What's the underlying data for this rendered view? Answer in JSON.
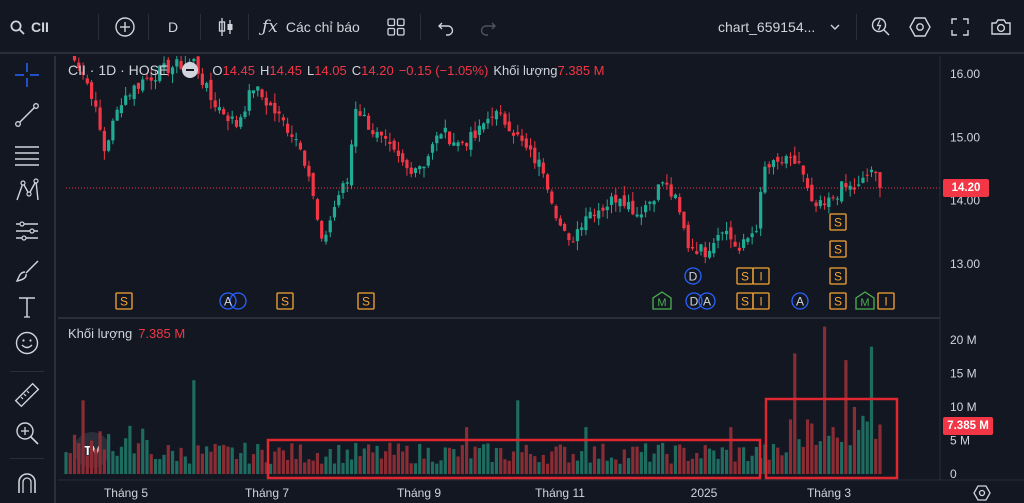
{
  "toolbar": {
    "symbol": "CII",
    "interval": "D",
    "indicators_label": "Các chỉ báo",
    "layout_name": "chart_659154...",
    "colors": {
      "bg": "#131722",
      "text": "#d1d4dc"
    }
  },
  "left_tools": [
    "crosshair-icon",
    "trendline-icon",
    "fib-icon",
    "pattern-icon",
    "projection-icon",
    "brush-icon",
    "text-icon",
    "emoji-icon",
    "ruler-icon",
    "zoom-icon",
    "magnet-icon"
  ],
  "legend": {
    "title": "CII · 1D · HOSE",
    "o_label": "O",
    "o_value": "14.45",
    "h_label": "H",
    "h_value": "14.45",
    "l_label": "L",
    "l_value": "14.05",
    "c_label": "C",
    "c_value": "14.20",
    "change": "−0.15 (−1.05%)",
    "volume_label": "Khối lượng",
    "volume_value": "7.385 M"
  },
  "volume_legend": {
    "label": "Khối lượng",
    "value": "7.385 M"
  },
  "price_axis": {
    "ticks": [
      "16.00",
      "15.00",
      "14.00",
      "13.00"
    ],
    "last_price": "14.20"
  },
  "volume_axis": {
    "ticks": [
      "20 M",
      "15 M",
      "10 M",
      "5 M",
      "0"
    ],
    "last_volume": "7.385 M"
  },
  "time_axis": {
    "ticks": [
      "Tháng 5",
      "Tháng 7",
      "Tháng 9",
      "Tháng 11",
      "2025",
      "Tháng 3"
    ]
  },
  "watermark": "TV",
  "event_markers": {
    "row_main": [
      "S",
      "A",
      "S",
      "S",
      "M",
      "D",
      "A",
      "S",
      "I",
      "A",
      "S",
      "M",
      "I"
    ],
    "row_stacked": [
      "D",
      "S",
      "I",
      "S",
      "S",
      "S"
    ]
  },
  "chart_data": {
    "type": "candlestick",
    "symbol": "CII",
    "interval": "1D",
    "exchange": "HOSE",
    "x_ticks": [
      "Tháng 5",
      "Tháng 7",
      "Tháng 9",
      "Tháng 11",
      "2025",
      "Tháng 3"
    ],
    "price_ylim": [
      12.3,
      16.3
    ],
    "price_anchors": [
      {
        "i": 0,
        "c": 16.6
      },
      {
        "i": 6,
        "c": 15.7
      },
      {
        "i": 9,
        "c": 14.8
      },
      {
        "i": 13,
        "c": 15.6
      },
      {
        "i": 18,
        "c": 15.9
      },
      {
        "i": 24,
        "c": 16.1
      },
      {
        "i": 30,
        "c": 16.2
      },
      {
        "i": 34,
        "c": 15.6
      },
      {
        "i": 40,
        "c": 15.2
      },
      {
        "i": 44,
        "c": 15.8
      },
      {
        "i": 49,
        "c": 15.4
      },
      {
        "i": 55,
        "c": 14.9
      },
      {
        "i": 57,
        "c": 14.4
      },
      {
        "i": 60,
        "c": 13.3
      },
      {
        "i": 64,
        "c": 14.1
      },
      {
        "i": 66,
        "c": 14.3
      },
      {
        "i": 68,
        "c": 15.5
      },
      {
        "i": 72,
        "c": 15.1
      },
      {
        "i": 76,
        "c": 14.8
      },
      {
        "i": 80,
        "c": 14.5
      },
      {
        "i": 84,
        "c": 14.6
      },
      {
        "i": 88,
        "c": 15.1
      },
      {
        "i": 92,
        "c": 14.9
      },
      {
        "i": 96,
        "c": 15.0
      },
      {
        "i": 100,
        "c": 15.4
      },
      {
        "i": 104,
        "c": 15.2
      },
      {
        "i": 108,
        "c": 14.8
      },
      {
        "i": 112,
        "c": 14.5
      },
      {
        "i": 116,
        "c": 13.6
      },
      {
        "i": 118,
        "c": 13.3
      },
      {
        "i": 122,
        "c": 13.8
      },
      {
        "i": 126,
        "c": 13.9
      },
      {
        "i": 130,
        "c": 14.1
      },
      {
        "i": 134,
        "c": 13.8
      },
      {
        "i": 137,
        "c": 14.0
      },
      {
        "i": 140,
        "c": 14.3
      },
      {
        "i": 143,
        "c": 14.0
      },
      {
        "i": 146,
        "c": 13.3
      },
      {
        "i": 150,
        "c": 13.2
      },
      {
        "i": 154,
        "c": 13.6
      },
      {
        "i": 158,
        "c": 13.2
      },
      {
        "i": 162,
        "c": 13.6
      },
      {
        "i": 164,
        "c": 14.5
      },
      {
        "i": 168,
        "c": 14.6
      },
      {
        "i": 172,
        "c": 14.6
      },
      {
        "i": 175,
        "c": 13.9
      },
      {
        "i": 178,
        "c": 13.9
      },
      {
        "i": 182,
        "c": 14.2
      },
      {
        "i": 186,
        "c": 14.2
      },
      {
        "i": 189,
        "c": 14.5
      },
      {
        "i": 191,
        "c": 14.2
      }
    ],
    "candle_count": 192,
    "volume_ylim": [
      0,
      21
    ],
    "volume_unit": "M",
    "last": {
      "open": 14.45,
      "high": 14.45,
      "low": 14.05,
      "close": 14.2,
      "change": -0.15,
      "change_pct": -1.05,
      "volume": 7.385
    },
    "colors": {
      "up": "#22ab94",
      "down": "#f23645",
      "vol_up": "#1e6b60",
      "vol_down": "#8a2c34",
      "price_line": "#f23645",
      "highlight": "#e0262f",
      "marker_orange": "#f7a534",
      "marker_blue": "#2962ff",
      "marker_green": "#4caf50"
    }
  }
}
